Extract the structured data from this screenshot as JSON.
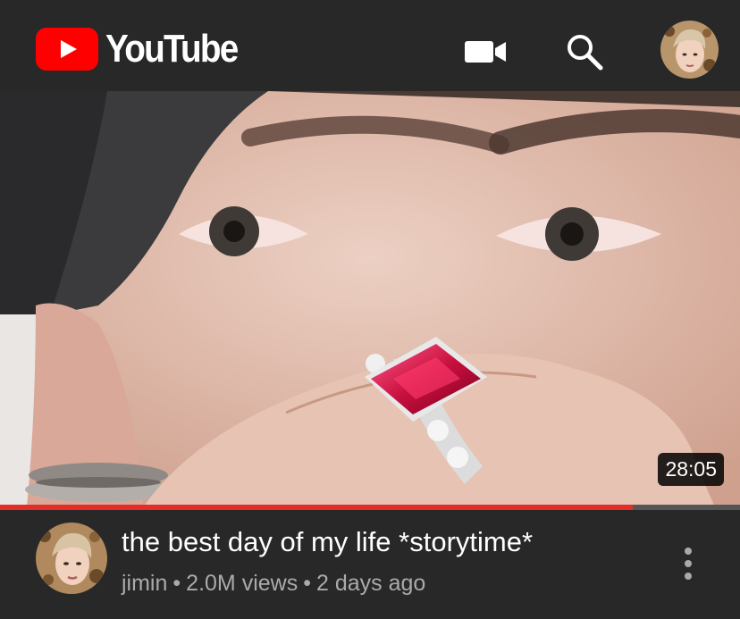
{
  "header": {
    "logo_text": "YouTube",
    "brand_color": "#FF0000",
    "icons": [
      "video-camera-icon",
      "search-icon",
      "account-avatar"
    ]
  },
  "video": {
    "duration": "28:05",
    "progress_fraction": 0.855,
    "progress_color": "#E52D27"
  },
  "info": {
    "title": "the best day of my life *storytime*",
    "channel": "jimin",
    "views": "2.0M views",
    "age": "2 days ago",
    "separator": "•",
    "menu_icon": "more-vertical-icon"
  }
}
